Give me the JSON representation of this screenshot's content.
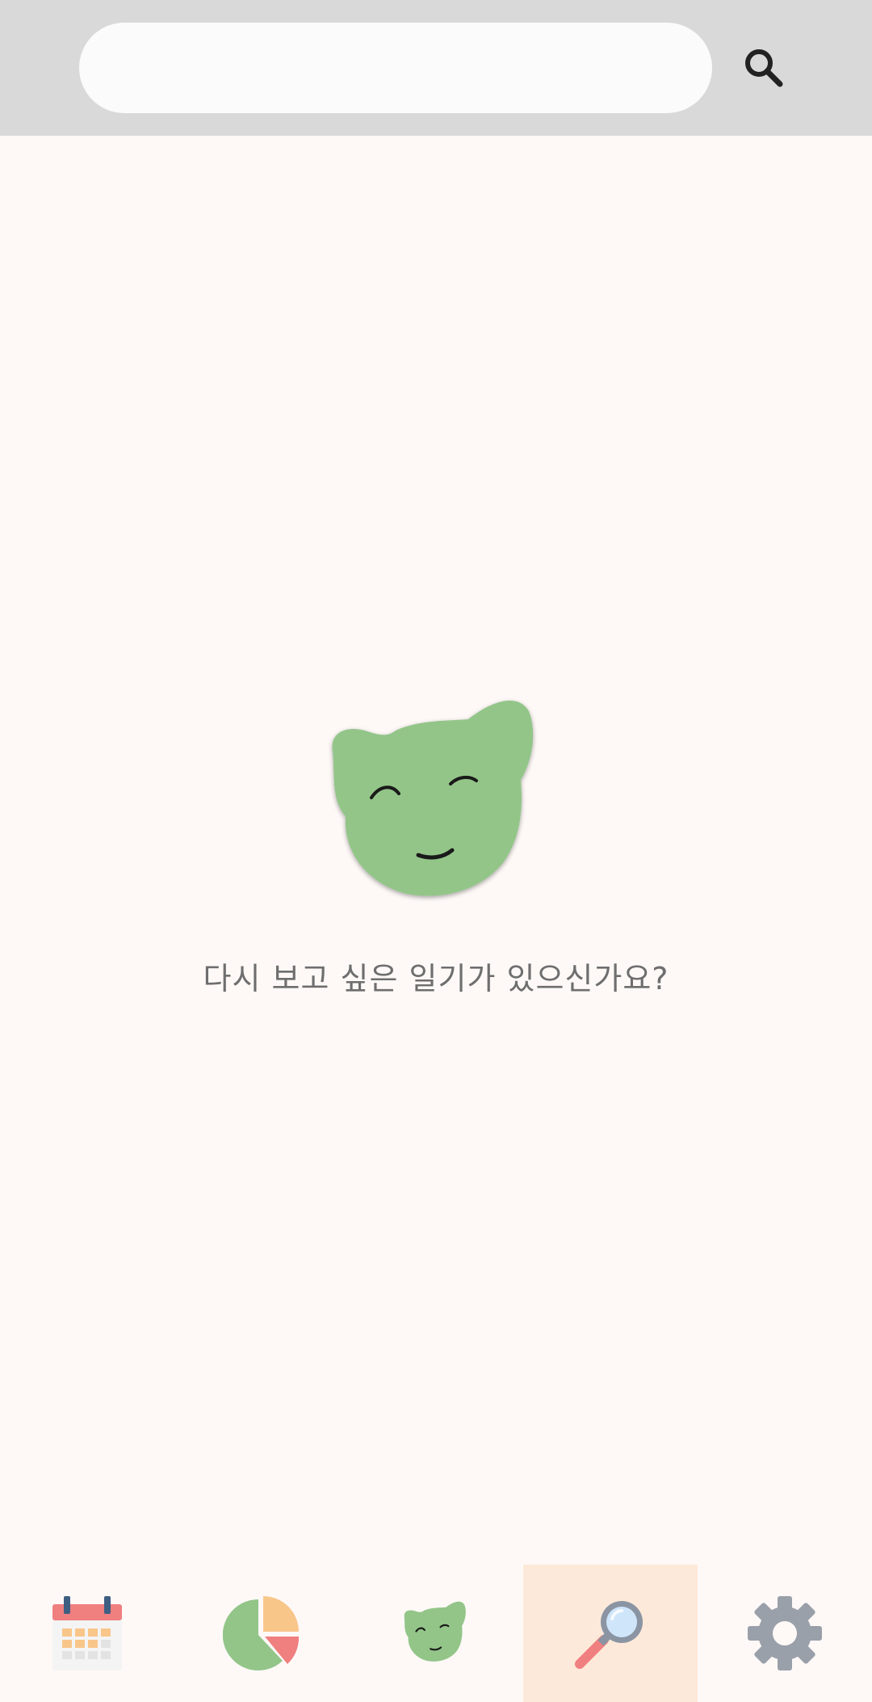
{
  "search": {
    "value": "",
    "placeholder": ""
  },
  "icons": {
    "search_button": "search-icon",
    "mascot": "smiling-green-cat-face"
  },
  "empty_state": {
    "message": "다시 보고 싶은 일기가 있으신가요?"
  },
  "bottom_nav": {
    "active_tab": "search",
    "items": [
      {
        "id": "calendar",
        "icon": "calendar-icon"
      },
      {
        "id": "statistics",
        "icon": "pie-chart-icon"
      },
      {
        "id": "home",
        "icon": "cat-face-icon"
      },
      {
        "id": "search",
        "icon": "magnifier-icon"
      },
      {
        "id": "settings",
        "icon": "gear-icon"
      }
    ]
  },
  "colors": {
    "topbar_bg": "#d9d9d9",
    "page_bg": "#fef9f7",
    "mascot_green": "#93c589",
    "active_tab_bg": "#fde9d9"
  }
}
